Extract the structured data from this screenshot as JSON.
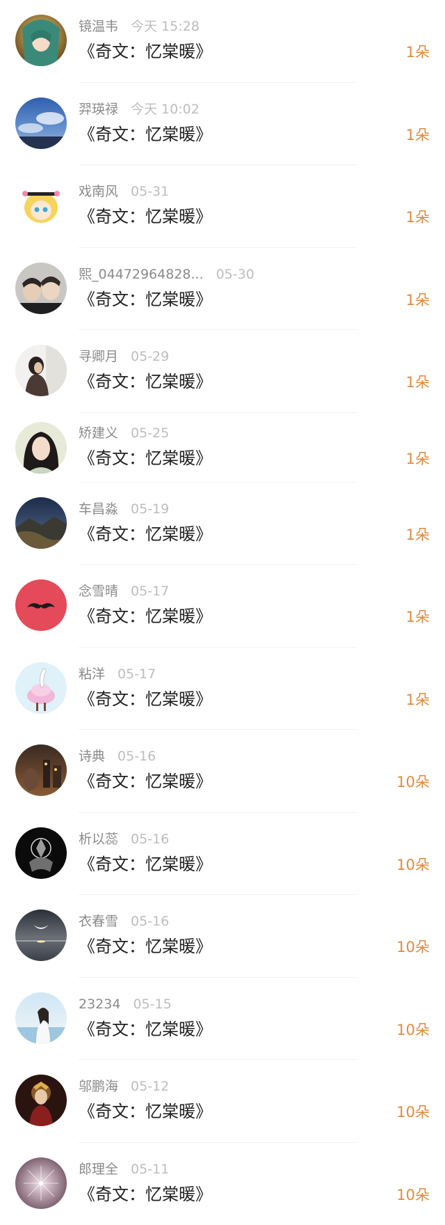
{
  "colors": {
    "name": "#8a8a8a",
    "time": "#bdbdbd",
    "title": "#222222",
    "count": "#e08a3c",
    "divider": "#f2f2f2"
  },
  "items": [
    {
      "name": "镜温韦",
      "time": "今天 15:28",
      "title": "《奇文：忆棠暖》",
      "count": "1朵",
      "avatar": "anime-girl"
    },
    {
      "name": "羿瑛禄",
      "time": "今天 10:02",
      "title": "《奇文：忆棠暖》",
      "count": "1朵",
      "avatar": "sky"
    },
    {
      "name": "戏南风",
      "time": "05-31",
      "title": "《奇文：忆棠暖》",
      "count": "1朵",
      "avatar": "cartoon-girl"
    },
    {
      "name": "熙_04472964828...",
      "time": "05-30",
      "title": "《奇文：忆棠暖》",
      "count": "1朵",
      "avatar": "couple"
    },
    {
      "name": "寻卿月",
      "time": "05-29",
      "title": "《奇文：忆棠暖》",
      "count": "1朵",
      "avatar": "woman-window"
    },
    {
      "name": "矫建义",
      "time": "05-25",
      "title": "《奇文：忆棠暖》",
      "count": "1朵",
      "avatar": "woman-portrait"
    },
    {
      "name": "车昌淼",
      "time": "05-19",
      "title": "《奇文：忆棠暖》",
      "count": "1朵",
      "avatar": "mountain-night"
    },
    {
      "name": "念雪晴",
      "time": "05-17",
      "title": "《奇文：忆棠暖》",
      "count": "1朵",
      "avatar": "mustache"
    },
    {
      "name": "粘洋",
      "time": "05-17",
      "title": "《奇文：忆棠暖》",
      "count": "1朵",
      "avatar": "goose"
    },
    {
      "name": "诗典",
      "time": "05-16",
      "title": "《奇文：忆棠暖》",
      "count": "10朵",
      "avatar": "city-night"
    },
    {
      "name": "析以蕊",
      "time": "05-16",
      "title": "《奇文：忆棠暖》",
      "count": "10朵",
      "avatar": "dark-emblem"
    },
    {
      "name": "衣春雪",
      "time": "05-16",
      "title": "《奇文：忆棠暖》",
      "count": "10朵",
      "avatar": "moon-lake"
    },
    {
      "name": "23234",
      "time": "05-15",
      "title": "《奇文：忆棠暖》",
      "count": "10朵",
      "avatar": "woman-sea"
    },
    {
      "name": "邬鹏海",
      "time": "05-12",
      "title": "《奇文：忆棠暖》",
      "count": "10朵",
      "avatar": "ancient-figure"
    },
    {
      "name": "郎理全",
      "time": "05-11",
      "title": "《奇文：忆棠暖》",
      "count": "10朵",
      "avatar": "dandelion"
    }
  ]
}
